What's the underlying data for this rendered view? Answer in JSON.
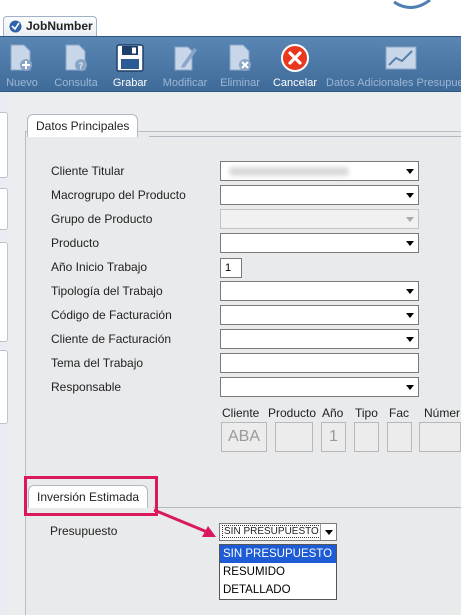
{
  "window": {
    "tab_title": "JobNumber"
  },
  "toolbar": {
    "buttons": [
      {
        "label": "Nuevo",
        "icon": "new-document-icon",
        "enabled": false
      },
      {
        "label": "Consulta",
        "icon": "query-document-icon",
        "enabled": false
      },
      {
        "label": "Grabar",
        "icon": "save-disk-icon",
        "enabled": true
      },
      {
        "label": "Modificar",
        "icon": "edit-document-icon",
        "enabled": false
      },
      {
        "label": "Eliminar",
        "icon": "delete-document-icon",
        "enabled": false
      },
      {
        "label": "Cancelar",
        "icon": "cancel-icon",
        "enabled": true
      },
      {
        "label": "Datos Adicionales Presupuesto",
        "icon": "chart-icon",
        "enabled": false
      }
    ]
  },
  "datos_principales": {
    "title": "Datos Principales",
    "fields": [
      {
        "label": "Cliente Titular",
        "value": "",
        "type": "select",
        "enabled": true
      },
      {
        "label": "Macrogrupo del Producto",
        "value": "",
        "type": "select",
        "enabled": true
      },
      {
        "label": "Grupo de Producto",
        "value": "",
        "type": "select",
        "enabled": false
      },
      {
        "label": "Producto",
        "value": "",
        "type": "select",
        "enabled": true
      },
      {
        "label": "Año Inicio Trabajo",
        "value": "1",
        "type": "text",
        "enabled": true
      },
      {
        "label": "Tipología del Trabajo",
        "value": "",
        "type": "select",
        "enabled": true
      },
      {
        "label": "Código de Facturación",
        "value": "",
        "type": "select",
        "enabled": true
      },
      {
        "label": "Cliente de Facturación",
        "value": "",
        "type": "select",
        "enabled": true
      },
      {
        "label": "Tema del Trabajo",
        "value": "",
        "type": "text",
        "enabled": true
      },
      {
        "label": "Responsable",
        "value": "",
        "type": "select",
        "enabled": true
      }
    ],
    "job_code": {
      "headers": [
        "Cliente",
        "Producto",
        "Año",
        "Tipo",
        "Fac",
        "Númer"
      ],
      "values": [
        "ABA",
        "",
        "1",
        "",
        "",
        ""
      ]
    }
  },
  "inversion_estimada": {
    "title": "Inversión Estimada",
    "presupuesto": {
      "label": "Presupuesto",
      "selected": "SIN PRESUPUESTO",
      "options": [
        "SIN PRESUPUESTO",
        "RESUMIDO",
        "DETALLADO"
      ]
    }
  },
  "colors": {
    "toolbar": "#4a77a8",
    "highlight": "#d9185f",
    "selection": "#1e5cd6"
  }
}
